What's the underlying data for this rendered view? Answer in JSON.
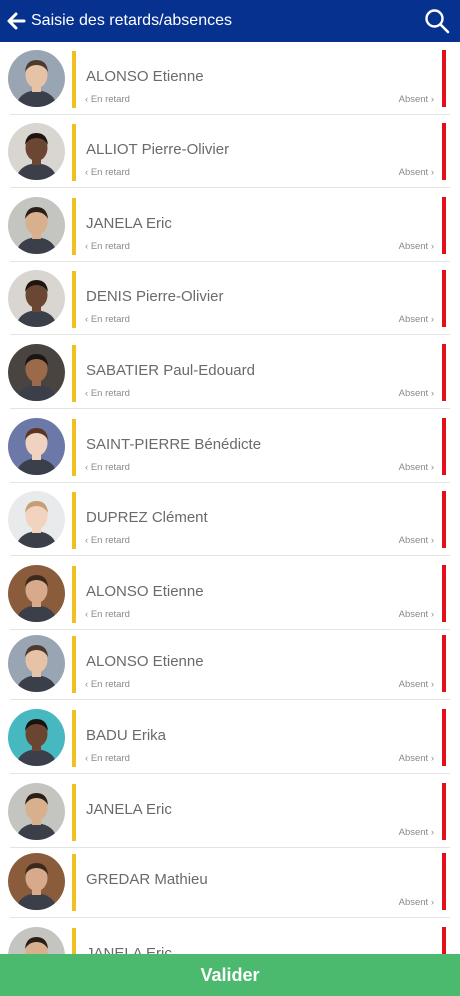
{
  "header": {
    "title": "Saisie des retards/absences"
  },
  "rows": [
    {
      "name": "ALONSO Etienne",
      "late": "En retard",
      "absent": "Absent",
      "skin": "#e6c2a6",
      "hair": "#4a3a30",
      "bg": "#9aa5b3"
    },
    {
      "name": "ALLIOT Pierre-Olivier",
      "late": "En retard",
      "absent": "Absent",
      "skin": "#6b4632",
      "hair": "#1e1510",
      "bg": "#d9d6d2"
    },
    {
      "name": "JANELA Eric",
      "late": "En retard",
      "absent": "Absent",
      "skin": "#d8b08e",
      "hair": "#2a1e18",
      "bg": "#c4c4c0"
    },
    {
      "name": "DENIS Pierre-Olivier",
      "late": "En retard",
      "absent": "Absent",
      "skin": "#6b4632",
      "hair": "#1e1510",
      "bg": "#d9d6d2"
    },
    {
      "name": "SABATIER Paul-Edouard",
      "late": "En retard",
      "absent": "Absent",
      "skin": "#9a6a4a",
      "hair": "#1a1412",
      "bg": "#4a4440"
    },
    {
      "name": "SAINT-PIERRE Bénédicte",
      "late": "En retard",
      "absent": "Absent",
      "skin": "#f0d2c0",
      "hair": "#5a3424",
      "bg": "#6c78a8"
    },
    {
      "name": "DUPREZ Clément",
      "late": "En retard",
      "absent": "Absent",
      "skin": "#f2d3bf",
      "hair": "#c89d73",
      "bg": "#e8eaec"
    },
    {
      "name": "ALONSO Etienne",
      "late": "En retard",
      "absent": "Absent",
      "skin": "#d8a98a",
      "hair": "#3a2a1e",
      "bg": "#8a5c3c"
    },
    {
      "name": "ALONSO Etienne",
      "late": "En retard",
      "absent": "Absent",
      "skin": "#e6c2a6",
      "hair": "#4a3a30",
      "bg": "#9aa5b3"
    },
    {
      "name": "BADU Erika",
      "late": "En retard",
      "absent": "Absent",
      "skin": "#6a4632",
      "hair": "#1a1210",
      "bg": "#48b8c0"
    },
    {
      "name": "JANELA Eric",
      "late": "",
      "absent": "Absent",
      "skin": "#d8b08e",
      "hair": "#2a1e18",
      "bg": "#c4c4c0"
    },
    {
      "name": "GREDAR Mathieu",
      "late": "",
      "absent": "Absent",
      "skin": "#d8a98a",
      "hair": "#3a2a1e",
      "bg": "#8a5c3c"
    },
    {
      "name": "JANELA Eric",
      "late": "",
      "absent": "",
      "skin": "#d8b08e",
      "hair": "#2a1e18",
      "bg": "#c4c4c0"
    }
  ],
  "footer": {
    "validate_label": "Valider"
  }
}
